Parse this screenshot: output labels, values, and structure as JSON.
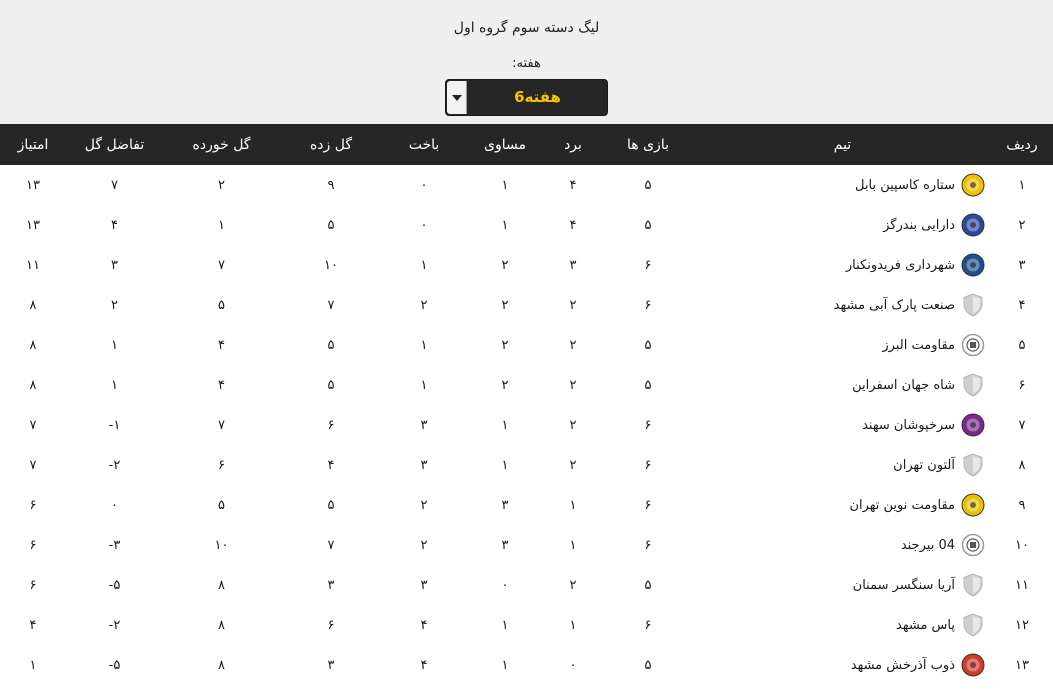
{
  "header": {
    "title": "لیگ دسته سوم گروه اول",
    "week_label": "هفته:",
    "week_selected": "هفته6"
  },
  "table": {
    "columns": [
      "ردیف",
      "تیم",
      "بازی ها",
      "برد",
      "مساوی",
      "باخت",
      "گل زده",
      "گل خورده",
      "تفاضل گل",
      "امتیاز"
    ],
    "rows": [
      {
        "rank": "۱",
        "team": "ستاره کاسپین بابل",
        "logo": "star-crest-icon",
        "logo_color": "#f0c000",
        "played": "۵",
        "won": "۴",
        "drawn": "۱",
        "lost": "۰",
        "gf": "۹",
        "ga": "۲",
        "gd": "۷",
        "pts": "۱۳"
      },
      {
        "rank": "۲",
        "team": "دارایی بندرگز",
        "logo": "blue-crest-icon",
        "logo_color": "#2a4aa0",
        "played": "۵",
        "won": "۴",
        "drawn": "۱",
        "lost": "۰",
        "gf": "۵",
        "ga": "۱",
        "gd": "۴",
        "pts": "۱۳"
      },
      {
        "rank": "۳",
        "team": "شهرداری فریدونکنار",
        "logo": "blue-gold-crest-icon",
        "logo_color": "#1f4f8f",
        "played": "۶",
        "won": "۳",
        "drawn": "۲",
        "lost": "۱",
        "gf": "۱۰",
        "ga": "۷",
        "gd": "۳",
        "pts": "۱۱"
      },
      {
        "rank": "۴",
        "team": "صنعت پارک آبی مشهد",
        "logo": "default-shield-icon",
        "logo_color": "#cfcfcf",
        "played": "۶",
        "won": "۲",
        "drawn": "۲",
        "lost": "۲",
        "gf": "۷",
        "ga": "۵",
        "gd": "۲",
        "pts": "۸"
      },
      {
        "rank": "۵",
        "team": "مقاومت البرز",
        "logo": "emblem-icon",
        "logo_color": "#9a9a9a",
        "played": "۵",
        "won": "۲",
        "drawn": "۲",
        "lost": "۱",
        "gf": "۵",
        "ga": "۴",
        "gd": "۱",
        "pts": "۸"
      },
      {
        "rank": "۶",
        "team": "شاه جهان اسفراین",
        "logo": "default-shield-icon",
        "logo_color": "#cfcfcf",
        "played": "۵",
        "won": "۲",
        "drawn": "۲",
        "lost": "۱",
        "gf": "۵",
        "ga": "۴",
        "gd": "۱",
        "pts": "۸"
      },
      {
        "rank": "۷",
        "team": "سرخپوشان سهند",
        "logo": "red-purple-crest-icon",
        "logo_color": "#7a2a8a",
        "played": "۶",
        "won": "۲",
        "drawn": "۱",
        "lost": "۳",
        "gf": "۶",
        "ga": "۷",
        "gd": "۱-",
        "pts": "۷"
      },
      {
        "rank": "۸",
        "team": "آلتون تهران",
        "logo": "default-shield-icon",
        "logo_color": "#cfcfcf",
        "played": "۶",
        "won": "۲",
        "drawn": "۱",
        "lost": "۳",
        "gf": "۴",
        "ga": "۶",
        "gd": "۲-",
        "pts": "۷"
      },
      {
        "rank": "۹",
        "team": "مقاومت نوین تهران",
        "logo": "yellow-sun-crest-icon",
        "logo_color": "#e8c000",
        "played": "۶",
        "won": "۱",
        "drawn": "۳",
        "lost": "۲",
        "gf": "۵",
        "ga": "۵",
        "gd": "۰",
        "pts": "۶"
      },
      {
        "rank": "۱۰",
        "team": "04 بیرجند",
        "logo": "emblem-icon",
        "logo_color": "#9a9a9a",
        "played": "۶",
        "won": "۱",
        "drawn": "۳",
        "lost": "۲",
        "gf": "۷",
        "ga": "۱۰",
        "gd": "۳-",
        "pts": "۶"
      },
      {
        "rank": "۱۱",
        "team": "آریا سنگسر سمنان",
        "logo": "default-shield-icon",
        "logo_color": "#cfcfcf",
        "played": "۵",
        "won": "۲",
        "drawn": "۰",
        "lost": "۳",
        "gf": "۳",
        "ga": "۸",
        "gd": "۵-",
        "pts": "۶"
      },
      {
        "rank": "۱۲",
        "team": "پاس مشهد",
        "logo": "default-shield-icon",
        "logo_color": "#cfcfcf",
        "played": "۶",
        "won": "۱",
        "drawn": "۱",
        "lost": "۴",
        "gf": "۶",
        "ga": "۸",
        "gd": "۲-",
        "pts": "۴"
      },
      {
        "rank": "۱۳",
        "team": "ذوب آذرخش مشهد",
        "logo": "red-flower-crest-icon",
        "logo_color": "#d23a2a",
        "played": "۵",
        "won": "۰",
        "drawn": "۱",
        "lost": "۴",
        "gf": "۳",
        "ga": "۸",
        "gd": "۵-",
        "pts": "۱"
      }
    ]
  }
}
